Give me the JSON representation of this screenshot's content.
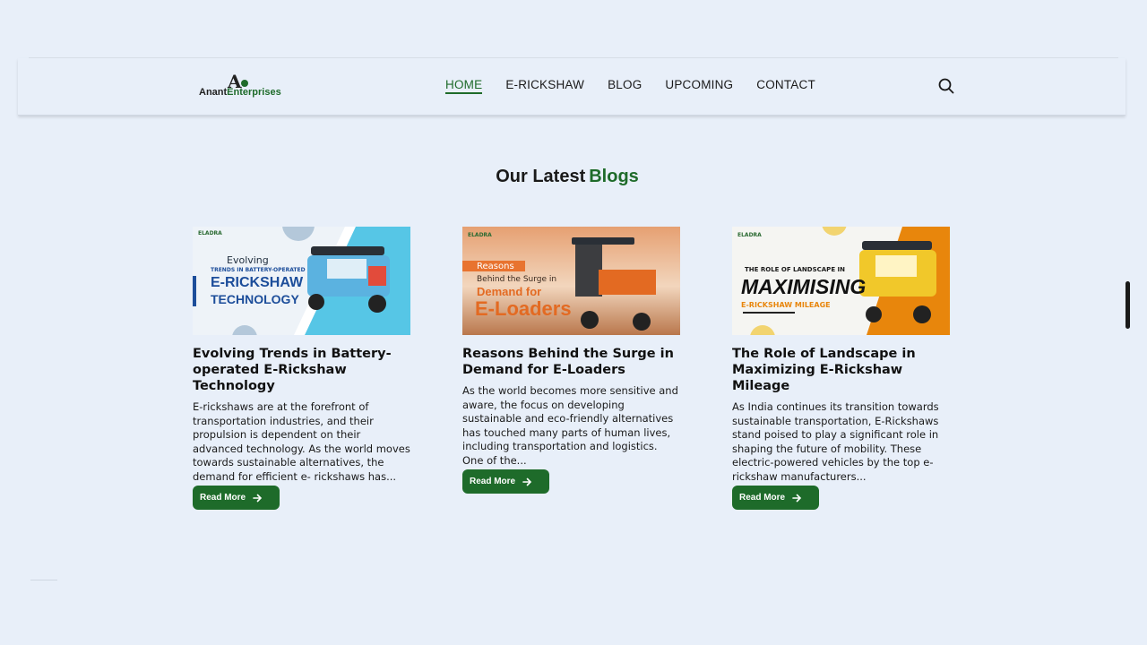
{
  "brand": {
    "mark": "A",
    "name_part1": "Anant",
    "name_part2": "Enterprises",
    "green": "#1e6b2a"
  },
  "nav": {
    "items": [
      {
        "label": "HOME",
        "active": true
      },
      {
        "label": "E-RICKSHAW",
        "active": false
      },
      {
        "label": "BLOG",
        "active": false
      },
      {
        "label": "UPCOMING",
        "active": false
      },
      {
        "label": "CONTACT",
        "active": false
      }
    ],
    "search_icon": "search-icon"
  },
  "section": {
    "title_part1": "Our Latest",
    "title_part2": "Blogs"
  },
  "cards": [
    {
      "image": {
        "brand": "ELADRA",
        "line1": "Evolving",
        "line2": "TRENDS IN BATTERY-OPERATED",
        "line3": "E-RICKSHAW",
        "line4": "TECHNOLOGY"
      },
      "title": "Evolving Trends in Battery-operated E-Rickshaw Technology",
      "excerpt": "E-rickshaws are at the forefront of transportation industries, and their propulsion is dependent on their advanced technology. As the world moves towards sustainable alternatives, the demand for efficient e- rickshaws has...",
      "button": "Read More"
    },
    {
      "image": {
        "brand": "ELADRA",
        "line1": "Reasons",
        "line2": "Behind the Surge in",
        "line3": "Demand for",
        "line4": "E-Loaders"
      },
      "title": "Reasons Behind the Surge in Demand for E-Loaders",
      "excerpt": "As the world becomes more sensitive and aware, the focus on developing sustainable and eco-friendly alternatives has touched many parts of human lives, including transportation and logistics. One of the...",
      "button": "Read More"
    },
    {
      "image": {
        "brand": "ELADRA",
        "line1": "THE ROLE OF LANDSCAPE IN",
        "line2": "MAXIMISING",
        "line3": "E-RICKSHAW MILEAGE"
      },
      "title": "The Role of Landscape in Maximizing E-Rickshaw Mileage",
      "excerpt": "As India continues its transition towards sustainable transportation, E-Rickshaws stand poised to play a significant role in shaping the future of mobility. These electric-powered vehicles by the top e-rickshaw manufacturers...",
      "button": "Read More"
    }
  ]
}
